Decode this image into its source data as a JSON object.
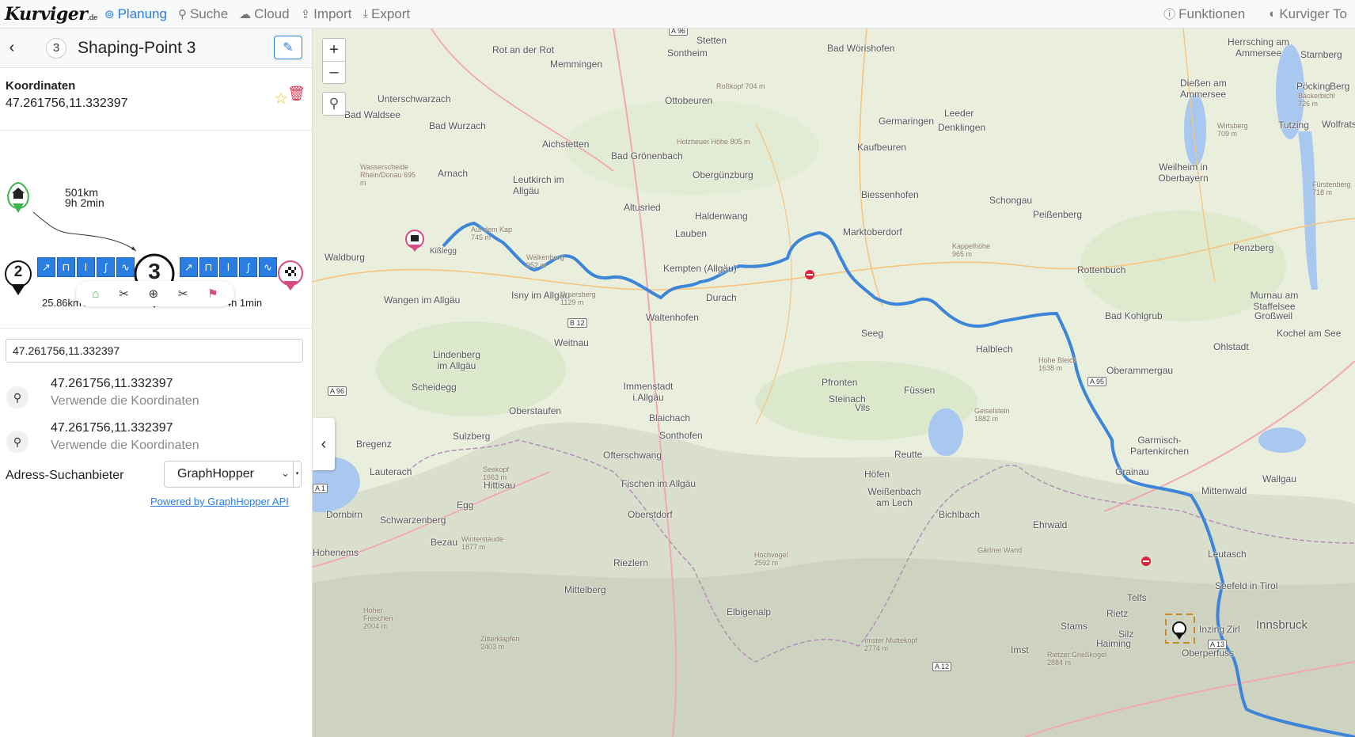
{
  "nav": {
    "logo_main": "Kurviger",
    "logo_suffix": ".de",
    "items": [
      {
        "label": "Planung",
        "icon": "compass-icon",
        "active": true
      },
      {
        "label": "Suche",
        "icon": "search-icon"
      },
      {
        "label": "Cloud",
        "icon": "cloud-icon"
      },
      {
        "label": "Import",
        "icon": "upload-icon"
      },
      {
        "label": "Export",
        "icon": "download-icon"
      }
    ],
    "right": [
      {
        "label": "Funktionen",
        "icon": "info-icon"
      },
      {
        "label": "Kurviger To",
        "icon": "kurviger-icon"
      }
    ]
  },
  "waypoint": {
    "number": "3",
    "title": "Shaping-Point 3",
    "coords_label": "Koordinaten",
    "coords": "47.261756,11.332397"
  },
  "route": {
    "total_distance": "501km",
    "total_time": "9h 2min",
    "prev_number": "2",
    "current_number": "3",
    "prev_segment": "25.86km / 33min",
    "next_segment": "206km / 4h 1min"
  },
  "search": {
    "value": "47.261756,11.332397",
    "results": [
      {
        "coords": "47.261756,11.332397",
        "hint": "Verwende die Koordinaten"
      },
      {
        "coords": "47.261756,11.332397",
        "hint": "Verwende die Koordinaten"
      }
    ]
  },
  "provider": {
    "label": "Adress-Suchanbieter",
    "selected": "GraphHopper",
    "powered": "Powered by GraphHopper API"
  },
  "map": {
    "zoom_in": "+",
    "zoom_out": "–",
    "road_labels": [
      "A 96",
      "B 12",
      "A 96",
      "A 95",
      "A 1",
      "A 12",
      "A 13"
    ],
    "places": [
      "Memmingen",
      "Stetten",
      "Sontheim",
      "Bad Wörishofen",
      "Herrsching am Ammersee",
      "Starnberg",
      "Rot an der Rot",
      "Ottobeuren",
      "Leeder",
      "Denklingen",
      "Dießen am Ammersee",
      "Pöcking",
      "Berg",
      "Bad Waldsee",
      "Unterschwarzach",
      "Bad Wurzach",
      "Aichstetten",
      "Bad Grönenbach",
      "Germaringen",
      "Kaufbeuren",
      "Tutzing",
      "Wolfratshau",
      "Obergünzburg",
      "Weilheim in Oberbayern",
      "Arnach",
      "Leutkirch im Allgäu",
      "Altusried",
      "Biessenhofen",
      "Schongau",
      "Haldenwang",
      "Lauben",
      "Marktoberdorf",
      "Peißenberg",
      "Kißlegg",
      "Penzberg",
      "Waldburg",
      "Kempten (Allgäu)",
      "Rottenbuch",
      "Wangen im Allgäu",
      "Isny im Allgäu",
      "Durach",
      "Murnau am Staffelsee",
      "Bad Kohlgrub",
      "Großweil",
      "Kochel am See",
      "Waltenhofen",
      "Weitnau",
      "Seeg",
      "Halblech",
      "Ohlstadt",
      "Lindenberg im Allgäu",
      "Oberammergau",
      "Immenstadt i.Allgäu",
      "Pfronten",
      "Steinach",
      "Vils",
      "Füssen",
      "Scheidegg",
      "Blaichach",
      "Oberstaufen",
      "Bregenz",
      "Sulzberg",
      "Sonthofen",
      "Ofterschwang",
      "Reutte",
      "Garmisch-Partenkirchen",
      "Lauterach",
      "Grainau",
      "Hittisau",
      "Fischen im Allgäu",
      "Höfen",
      "Weißenbach am Lech",
      "Mittenwald",
      "Egg",
      "Dornbirn",
      "Schwarzenberg",
      "Oberstdorf",
      "Bichlbach",
      "Ehrwald",
      "Bezau",
      "Leutasch",
      "Hohenems",
      "Riezlern",
      "Seefeld in Tirol",
      "Mittelberg",
      "Elbigenalp",
      "Telfs",
      "Rietz",
      "Stams",
      "Inzing",
      "Zirl",
      "Innsbruck",
      "Silz",
      "Haiming",
      "Imst",
      "Oberperfuss",
      "Wallgau",
      "Leeder"
    ],
    "peaks": [
      "Roßkopf 704 m",
      "Holzheuer Höhe 805 m",
      "Wasserscheide Rhein/Donau 695 m",
      "Auf dem Kap 745 m",
      "Walkenberg 952 m",
      "Ursersberg 1129 m",
      "Kappelhöhe 965 m",
      "Hohe Bleick 1638 m",
      "Geiselstein 1882 m",
      "Seekopf 1663 m",
      "Hochvogel 2592 m",
      "Winterstaude 1877 m",
      "Hoher Freschen 2004 m",
      "Zitterklapfen 2403 m",
      "Gärtner Wand",
      "Imster Muttekopf 2774 m",
      "Rietzer Grießkogel 2884 m",
      "Wirtsberg 709 m",
      "Bäckerbichl 726 m",
      "Fürstenberg 718 m"
    ],
    "route_color": "#3d85d8"
  }
}
